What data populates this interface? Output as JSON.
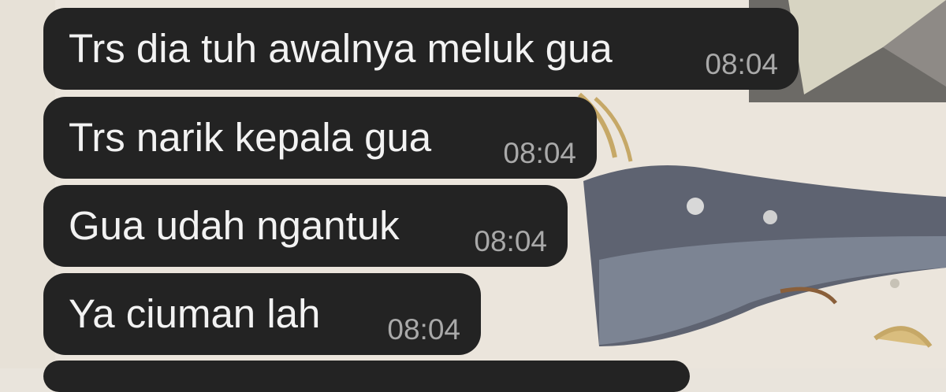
{
  "chat": {
    "theme": {
      "bubble_bg": "#232323",
      "text_color": "#f2f2f2",
      "time_color": "#a9a9a9"
    },
    "messages": [
      {
        "text": "Trs dia tuh awalnya meluk gua",
        "time": "08:04"
      },
      {
        "text": "Trs narik kepala gua",
        "time": "08:04"
      },
      {
        "text": "Gua udah ngantuk",
        "time": "08:04"
      },
      {
        "text": "Ya ciuman lah",
        "time": "08:04"
      }
    ]
  }
}
